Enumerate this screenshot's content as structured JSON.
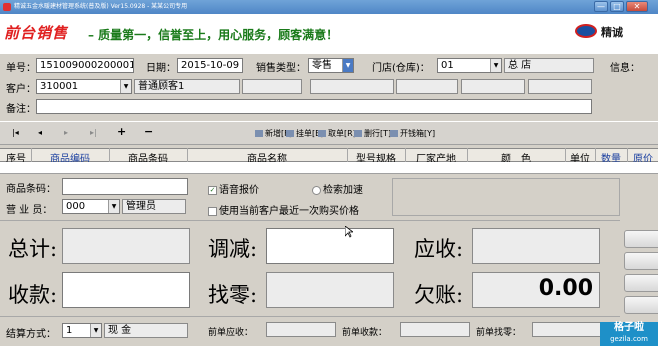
{
  "window": {
    "title": "精诚五金水暖建材管理系统(普及版) Ver15.0928 - 某某公司专用",
    "minimize": "—",
    "maximize": "□",
    "close": "✕"
  },
  "banner": {
    "brand": "前台销售",
    "slogan": "– 质量第一，信誉至上，用心服务，顾客满意！",
    "logo_text": "精诚",
    "logo_colors": {
      "oval": "#1a4fa0",
      "ring": "#d02020"
    }
  },
  "form": {
    "order_no_label": "单号：",
    "order_no": "151009000200001",
    "date_label": "日期：",
    "date": "2015-10-09",
    "sale_type_label": "销售类型：",
    "sale_type": "零售",
    "store_label": "门店(仓库)：",
    "store_code": "01",
    "store_name": "总  店",
    "info_label": "信息：",
    "customer_label": "客户：",
    "customer_code": "310001",
    "customer_name": "普通顾客1",
    "remark_label": "备注："
  },
  "toolbar": {
    "first": "|◂",
    "prev": "◂",
    "next": "▸",
    "last": "▸|",
    "add": "+",
    "remove": "−",
    "buttons": [
      "新增[F]",
      "挂单[E]",
      "取单[R]",
      "删行[T]",
      "开钱箱[Y]"
    ]
  },
  "grid": {
    "columns": [
      "序号",
      "商品编码",
      "商品条码",
      "商品名称",
      "型号规格",
      "厂家产地",
      "颜　色",
      "单位",
      "数量",
      "原价"
    ]
  },
  "entry": {
    "barcode_label": "商品条码：",
    "salesperson_label": "营 业 员：",
    "salesperson_code": "000",
    "salesperson_name": "管理员",
    "voice_label": "语音报价",
    "voice_checked": true,
    "speed_label": "检索加速",
    "last_price_label": "使用当前客户最近一次购买价格"
  },
  "totals": {
    "total_label": "总计:",
    "adjust_label": "调减:",
    "receivable_label": "应收:",
    "received_label": "收款:",
    "change_label": "找零:",
    "owed_label": "欠账:",
    "owed_value": "0.00"
  },
  "footer": {
    "settle_label": "结算方式：",
    "settle_code": "1",
    "settle_name": "现  金",
    "prev_receivable_label": "前单应收：",
    "prev_received_label": "前单收款：",
    "prev_change_label": "前单找零："
  },
  "watermark": {
    "line1": "格子啦",
    "line2": "gezila.com"
  }
}
